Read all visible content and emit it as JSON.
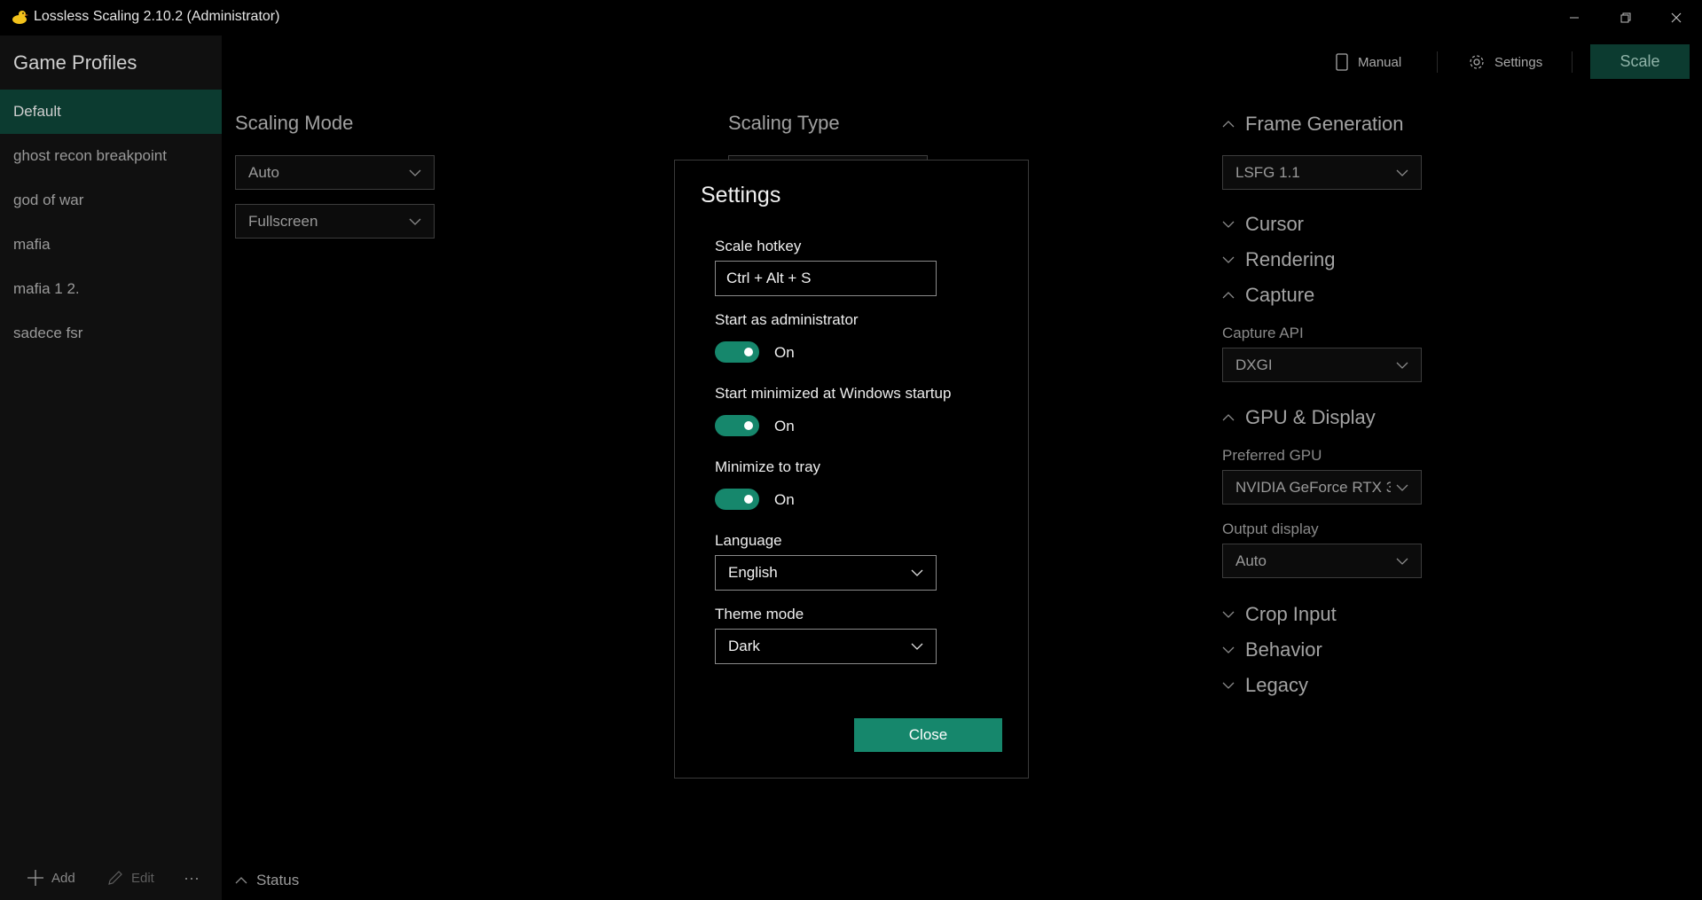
{
  "window": {
    "title": "Lossless Scaling 2.10.2 (Administrator)",
    "icon": "duck-icon",
    "controls": [
      "minimize-icon",
      "restore-icon",
      "close-icon"
    ]
  },
  "sidebar": {
    "heading": "Game Profiles",
    "profiles": [
      {
        "label": "Default",
        "active": true
      },
      {
        "label": "ghost recon breakpoint"
      },
      {
        "label": "god of war"
      },
      {
        "label": "mafia"
      },
      {
        "label": "mafia 1 2."
      },
      {
        "label": "sadece fsr"
      }
    ],
    "actions": {
      "add": "Add",
      "edit": "Edit",
      "more": "···"
    }
  },
  "header": {
    "manual": "Manual",
    "settings": "Settings",
    "scale": "Scale"
  },
  "main": {
    "scaling_mode": {
      "heading": "Scaling Mode",
      "mode": "Auto",
      "display": "Fullscreen"
    },
    "scaling_type": {
      "heading": "Scaling Type"
    },
    "status": "Status"
  },
  "right_panel": {
    "frame_generation": {
      "heading": "Frame Generation",
      "expanded": true,
      "value": "LSFG 1.1"
    },
    "cursor": {
      "heading": "Cursor",
      "expanded": false
    },
    "rendering": {
      "heading": "Rendering",
      "expanded": false
    },
    "capture": {
      "heading": "Capture",
      "expanded": true,
      "api_label": "Capture API",
      "api_value": "DXGI"
    },
    "gpu_display": {
      "heading": "GPU & Display",
      "expanded": true,
      "gpu_label": "Preferred GPU",
      "gpu_value": "NVIDIA GeForce RTX 3",
      "output_label": "Output display",
      "output_value": "Auto"
    },
    "crop_input": {
      "heading": "Crop Input",
      "expanded": false
    },
    "behavior": {
      "heading": "Behavior",
      "expanded": false
    },
    "legacy": {
      "heading": "Legacy",
      "expanded": false
    }
  },
  "dialog": {
    "title": "Settings",
    "hotkey_label": "Scale hotkey",
    "hotkey_value": "Ctrl + Alt + S",
    "admin_label": "Start as administrator",
    "admin_state": "On",
    "startup_label": "Start minimized at Windows startup",
    "startup_state": "On",
    "tray_label": "Minimize to tray",
    "tray_state": "On",
    "language_label": "Language",
    "language_value": "English",
    "theme_label": "Theme mode",
    "theme_value": "Dark",
    "close": "Close"
  },
  "colors": {
    "background": "#000000",
    "sidebar": "#101010",
    "accent": "#16876c",
    "accent_dark": "#0c3b30"
  }
}
